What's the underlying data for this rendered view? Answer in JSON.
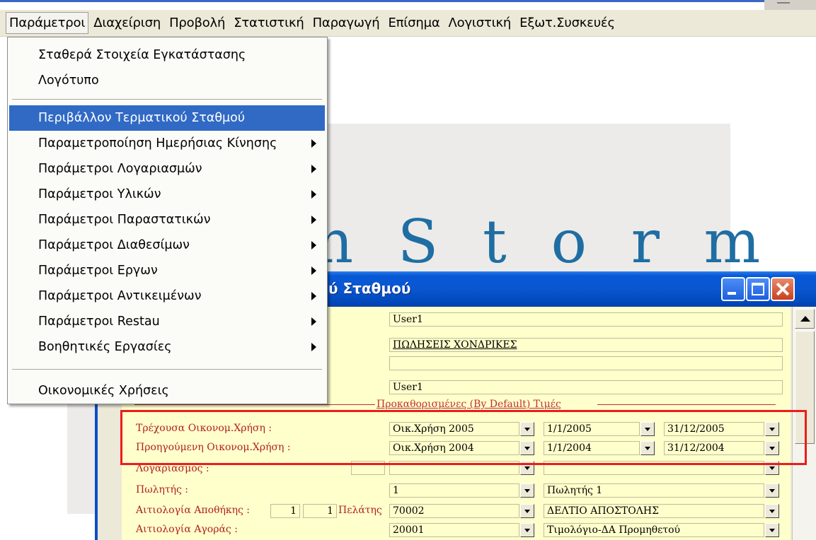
{
  "menubar": {
    "items": [
      "Παράμετροι",
      "Διαχείριση",
      "Προβολή",
      "Στατιστική",
      "Παραγωγή",
      "Επίσημα",
      "Λογιστική",
      "Εξωτ.Συσκευές"
    ]
  },
  "dropdown": {
    "items": [
      {
        "label": "Σταθερά Στοιχεία Εγκατάστασης"
      },
      {
        "label": "Λογότυπο"
      },
      {
        "label": "Περιβάλλον Τερματικού Σταθμού",
        "selected": true
      },
      {
        "label": "Παραμετροποίηση Ημερήσιας Κίνησης",
        "submenu": true
      },
      {
        "label": "Παράμετροι Λογαριασμών",
        "submenu": true
      },
      {
        "label": "Παράμετροι Υλικών",
        "submenu": true
      },
      {
        "label": "Παράμετροι Παραστατικών",
        "submenu": true
      },
      {
        "label": "Παράμετροι Διαθεσίμων",
        "submenu": true
      },
      {
        "label": "Παράμετροι Εργων",
        "submenu": true
      },
      {
        "label": "Παράμετροι Αντικειμένων",
        "submenu": true
      },
      {
        "label": "Παράμετροι Restau",
        "submenu": true
      },
      {
        "label": "Βοηθητικές Εργασίες",
        "submenu": true
      },
      {
        "label": "Οικονομικές Χρήσεις"
      }
    ]
  },
  "background_logo": "n S t o r m",
  "dialog": {
    "title": "ύ Σταθμού",
    "fields_top": [
      "User1",
      "ΠΩΛΗΣΕΙΣ ΧΟΝΔΡΙΚΕΣ",
      "",
      "User1"
    ],
    "section_title": "Προκαθορισμένες (By Default) Τιμές",
    "current_year": {
      "label": "Τρέχουσα Οικονομ.Χρήση :",
      "value": "Οικ.Χρήση 2005",
      "from": "1/1/2005",
      "to": "31/12/2005"
    },
    "previous_year": {
      "label": "Προηγούμενη Οικονομ.Χρήση :",
      "value": "Οικ.Χρήση 2004",
      "from": "1/1/2004",
      "to": "31/12/2004"
    },
    "account": {
      "label": "Λογαριασμός :"
    },
    "salesman": {
      "label": "Πωλητής :",
      "code": "1",
      "name": "Πωλητής 1"
    },
    "warehouse_reason": {
      "label": "Αιτιολογία Αποθήκης :",
      "n1": "1",
      "n2": "1",
      "customer_label": "Πελάτης",
      "code": "70002",
      "name": "ΔΕΛΤΙΟ ΑΠΟΣΤΟΛΗΣ"
    },
    "purchase_reason": {
      "label": "Αιτιολογία Αγοράς :",
      "code": "20001",
      "name": "Τιμολόγιο-ΔΑ Προμηθετού"
    }
  },
  "colors": {
    "highlight": "#ee1c1c",
    "menu_selection": "#316ac5",
    "titlebar": "#0a56d0",
    "form_background": "#ffffcc",
    "label_text": "#b02020"
  }
}
